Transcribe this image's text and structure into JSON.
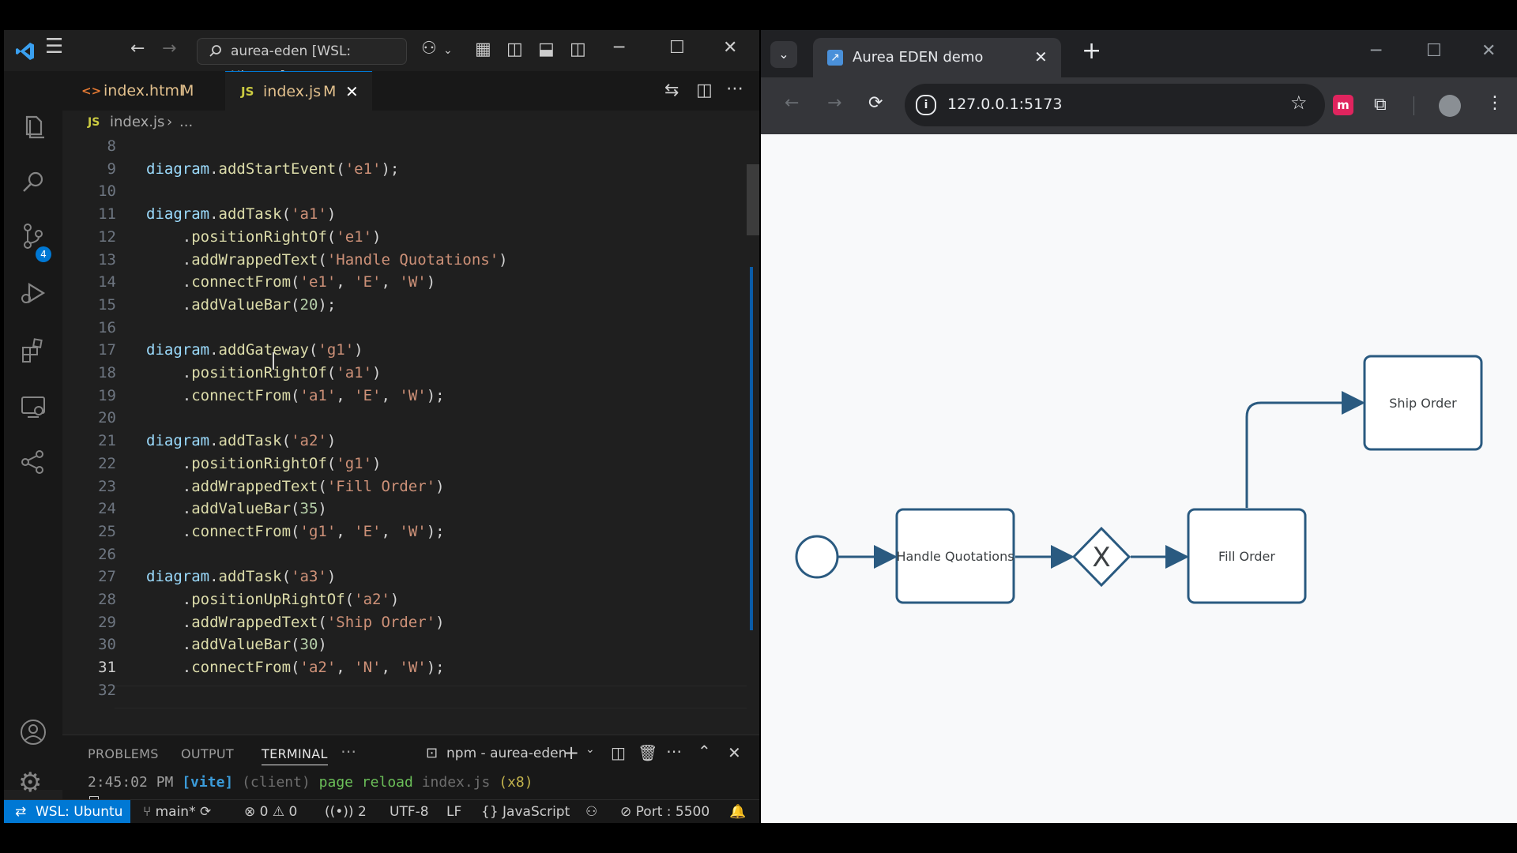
{
  "vscode": {
    "title": "aurea-eden [WSL: Ubuntu]",
    "tabs": [
      {
        "icon": "<>",
        "label": "index.html",
        "badge": "M"
      },
      {
        "icon": "JS",
        "label": "index.js",
        "badge": "M"
      }
    ],
    "breadcrumb": {
      "icon": "JS",
      "file": "index.js",
      "rest": "..."
    },
    "source_control_badge": "4",
    "code_lines": [
      {
        "n": "8",
        "text": ""
      },
      {
        "n": "9",
        "text": "diagram.addStartEvent('e1');"
      },
      {
        "n": "10",
        "text": ""
      },
      {
        "n": "11",
        "text": "diagram.addTask('a1')"
      },
      {
        "n": "12",
        "text": "    .positionRightOf('e1')"
      },
      {
        "n": "13",
        "text": "    .addWrappedText('Handle Quotations')"
      },
      {
        "n": "14",
        "text": "    .connectFrom('e1', 'E', 'W')"
      },
      {
        "n": "15",
        "text": "    .addValueBar(20);"
      },
      {
        "n": "16",
        "text": ""
      },
      {
        "n": "17",
        "text": "diagram.addGateway('g1')"
      },
      {
        "n": "18",
        "text": "    .positionRightOf('a1')"
      },
      {
        "n": "19",
        "text": "    .connectFrom('a1', 'E', 'W');"
      },
      {
        "n": "20",
        "text": ""
      },
      {
        "n": "21",
        "text": "diagram.addTask('a2')"
      },
      {
        "n": "22",
        "text": "    .positionRightOf('g1')"
      },
      {
        "n": "23",
        "text": "    .addWrappedText('Fill Order')"
      },
      {
        "n": "24",
        "text": "    .addValueBar(35)"
      },
      {
        "n": "25",
        "text": "    .connectFrom('g1', 'E', 'W');"
      },
      {
        "n": "26",
        "text": ""
      },
      {
        "n": "27",
        "text": "diagram.addTask('a3')"
      },
      {
        "n": "28",
        "text": "    .positionUpRightOf('a2')"
      },
      {
        "n": "29",
        "text": "    .addWrappedText('Ship Order')"
      },
      {
        "n": "30",
        "text": "    .addValueBar(30)"
      },
      {
        "n": "31",
        "text": "    .connectFrom('a2', 'N', 'W');"
      },
      {
        "n": "32",
        "text": ""
      }
    ],
    "current_line": "31",
    "panel": {
      "tabs": [
        "PROBLEMS",
        "OUTPUT",
        "TERMINAL"
      ],
      "active_tab": "TERMINAL",
      "terminal_name": "npm - aurea-eden",
      "terminal_line": {
        "time": "2:45:02 PM",
        "tag": "[vite]",
        "scope": "(client)",
        "message": "page reload",
        "file": "index.js",
        "count": "(x8)"
      }
    },
    "statusbar": {
      "remote": "WSL: Ubuntu",
      "branch": "main*",
      "errors": "0",
      "warnings": "0",
      "ports": "2",
      "encoding": "UTF-8",
      "eol": "LF",
      "language": "JavaScript",
      "port": "Port : 5500"
    },
    "colors": {
      "accent": "#0078d4",
      "modified": "#e2c08d",
      "js_icon": "#cbcb41",
      "html_icon": "#e37933"
    }
  },
  "chrome": {
    "tab_title": "Aurea EDEN demo",
    "url": "127.0.0.1:5173"
  },
  "diagram": {
    "nodes": [
      {
        "id": "e1",
        "type": "start-event",
        "label": ""
      },
      {
        "id": "a1",
        "type": "task",
        "label": "Handle Quotations"
      },
      {
        "id": "g1",
        "type": "exclusive-gateway",
        "label": "X"
      },
      {
        "id": "a2",
        "type": "task",
        "label": "Fill Order"
      },
      {
        "id": "a3",
        "type": "task",
        "label": "Ship Order"
      }
    ],
    "edges": [
      {
        "from": "e1",
        "to": "a1"
      },
      {
        "from": "a1",
        "to": "g1"
      },
      {
        "from": "g1",
        "to": "a2"
      },
      {
        "from": "a2",
        "to": "a3"
      }
    ],
    "stroke_color": "#2a5a80"
  }
}
